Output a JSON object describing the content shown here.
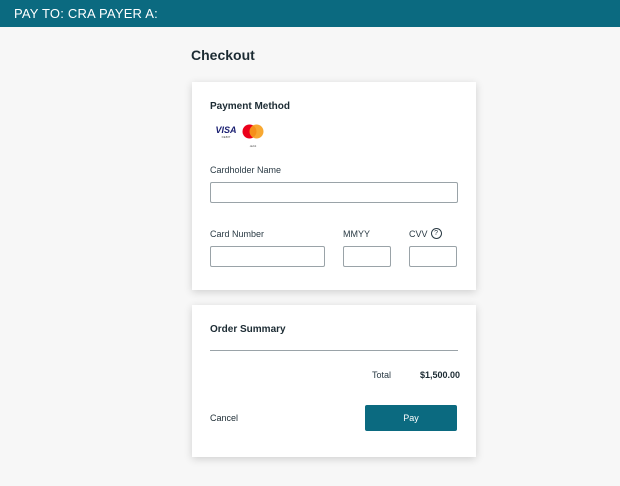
{
  "header": {
    "title": "PAY TO: CRA PAYER A:"
  },
  "page": {
    "title": "Checkout"
  },
  "payment": {
    "title": "Payment Method",
    "cards": [
      {
        "brand": "VISA",
        "sub": "DEBIT",
        "icon": "visa-debit-icon"
      },
      {
        "brand": "mastercard",
        "sub": "debit",
        "icon": "mastercard-debit-icon"
      }
    ],
    "cardholder_label": "Cardholder Name",
    "cardholder_value": "",
    "card_number_label": "Card Number",
    "card_number_value": "",
    "expiry_label": "MMYY",
    "expiry_value": "",
    "cvv_label": "CVV",
    "cvv_help": "?",
    "cvv_value": ""
  },
  "summary": {
    "title": "Order Summary",
    "total_label": "Total",
    "total_value": "$1,500.00",
    "cancel_label": "Cancel",
    "pay_label": "Pay"
  },
  "colors": {
    "accent": "#0b6a80",
    "background": "#f7f7f7",
    "visa": "#1a1f71",
    "mc_red": "#eb001b",
    "mc_orange": "#f79e1b"
  }
}
